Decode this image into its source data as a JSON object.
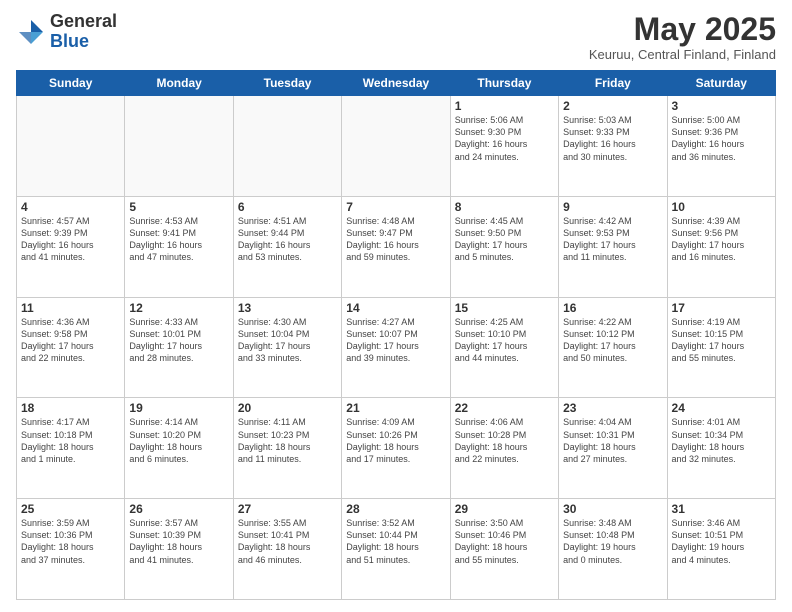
{
  "logo": {
    "general": "General",
    "blue": "Blue"
  },
  "header": {
    "title": "May 2025",
    "subtitle": "Keuruu, Central Finland, Finland"
  },
  "days_of_week": [
    "Sunday",
    "Monday",
    "Tuesday",
    "Wednesday",
    "Thursday",
    "Friday",
    "Saturday"
  ],
  "weeks": [
    [
      {
        "day": "",
        "info": ""
      },
      {
        "day": "",
        "info": ""
      },
      {
        "day": "",
        "info": ""
      },
      {
        "day": "",
        "info": ""
      },
      {
        "day": "1",
        "info": "Sunrise: 5:06 AM\nSunset: 9:30 PM\nDaylight: 16 hours\nand 24 minutes."
      },
      {
        "day": "2",
        "info": "Sunrise: 5:03 AM\nSunset: 9:33 PM\nDaylight: 16 hours\nand 30 minutes."
      },
      {
        "day": "3",
        "info": "Sunrise: 5:00 AM\nSunset: 9:36 PM\nDaylight: 16 hours\nand 36 minutes."
      }
    ],
    [
      {
        "day": "4",
        "info": "Sunrise: 4:57 AM\nSunset: 9:39 PM\nDaylight: 16 hours\nand 41 minutes."
      },
      {
        "day": "5",
        "info": "Sunrise: 4:53 AM\nSunset: 9:41 PM\nDaylight: 16 hours\nand 47 minutes."
      },
      {
        "day": "6",
        "info": "Sunrise: 4:51 AM\nSunset: 9:44 PM\nDaylight: 16 hours\nand 53 minutes."
      },
      {
        "day": "7",
        "info": "Sunrise: 4:48 AM\nSunset: 9:47 PM\nDaylight: 16 hours\nand 59 minutes."
      },
      {
        "day": "8",
        "info": "Sunrise: 4:45 AM\nSunset: 9:50 PM\nDaylight: 17 hours\nand 5 minutes."
      },
      {
        "day": "9",
        "info": "Sunrise: 4:42 AM\nSunset: 9:53 PM\nDaylight: 17 hours\nand 11 minutes."
      },
      {
        "day": "10",
        "info": "Sunrise: 4:39 AM\nSunset: 9:56 PM\nDaylight: 17 hours\nand 16 minutes."
      }
    ],
    [
      {
        "day": "11",
        "info": "Sunrise: 4:36 AM\nSunset: 9:58 PM\nDaylight: 17 hours\nand 22 minutes."
      },
      {
        "day": "12",
        "info": "Sunrise: 4:33 AM\nSunset: 10:01 PM\nDaylight: 17 hours\nand 28 minutes."
      },
      {
        "day": "13",
        "info": "Sunrise: 4:30 AM\nSunset: 10:04 PM\nDaylight: 17 hours\nand 33 minutes."
      },
      {
        "day": "14",
        "info": "Sunrise: 4:27 AM\nSunset: 10:07 PM\nDaylight: 17 hours\nand 39 minutes."
      },
      {
        "day": "15",
        "info": "Sunrise: 4:25 AM\nSunset: 10:10 PM\nDaylight: 17 hours\nand 44 minutes."
      },
      {
        "day": "16",
        "info": "Sunrise: 4:22 AM\nSunset: 10:12 PM\nDaylight: 17 hours\nand 50 minutes."
      },
      {
        "day": "17",
        "info": "Sunrise: 4:19 AM\nSunset: 10:15 PM\nDaylight: 17 hours\nand 55 minutes."
      }
    ],
    [
      {
        "day": "18",
        "info": "Sunrise: 4:17 AM\nSunset: 10:18 PM\nDaylight: 18 hours\nand 1 minute."
      },
      {
        "day": "19",
        "info": "Sunrise: 4:14 AM\nSunset: 10:20 PM\nDaylight: 18 hours\nand 6 minutes."
      },
      {
        "day": "20",
        "info": "Sunrise: 4:11 AM\nSunset: 10:23 PM\nDaylight: 18 hours\nand 11 minutes."
      },
      {
        "day": "21",
        "info": "Sunrise: 4:09 AM\nSunset: 10:26 PM\nDaylight: 18 hours\nand 17 minutes."
      },
      {
        "day": "22",
        "info": "Sunrise: 4:06 AM\nSunset: 10:28 PM\nDaylight: 18 hours\nand 22 minutes."
      },
      {
        "day": "23",
        "info": "Sunrise: 4:04 AM\nSunset: 10:31 PM\nDaylight: 18 hours\nand 27 minutes."
      },
      {
        "day": "24",
        "info": "Sunrise: 4:01 AM\nSunset: 10:34 PM\nDaylight: 18 hours\nand 32 minutes."
      }
    ],
    [
      {
        "day": "25",
        "info": "Sunrise: 3:59 AM\nSunset: 10:36 PM\nDaylight: 18 hours\nand 37 minutes."
      },
      {
        "day": "26",
        "info": "Sunrise: 3:57 AM\nSunset: 10:39 PM\nDaylight: 18 hours\nand 41 minutes."
      },
      {
        "day": "27",
        "info": "Sunrise: 3:55 AM\nSunset: 10:41 PM\nDaylight: 18 hours\nand 46 minutes."
      },
      {
        "day": "28",
        "info": "Sunrise: 3:52 AM\nSunset: 10:44 PM\nDaylight: 18 hours\nand 51 minutes."
      },
      {
        "day": "29",
        "info": "Sunrise: 3:50 AM\nSunset: 10:46 PM\nDaylight: 18 hours\nand 55 minutes."
      },
      {
        "day": "30",
        "info": "Sunrise: 3:48 AM\nSunset: 10:48 PM\nDaylight: 19 hours\nand 0 minutes."
      },
      {
        "day": "31",
        "info": "Sunrise: 3:46 AM\nSunset: 10:51 PM\nDaylight: 19 hours\nand 4 minutes."
      }
    ]
  ]
}
